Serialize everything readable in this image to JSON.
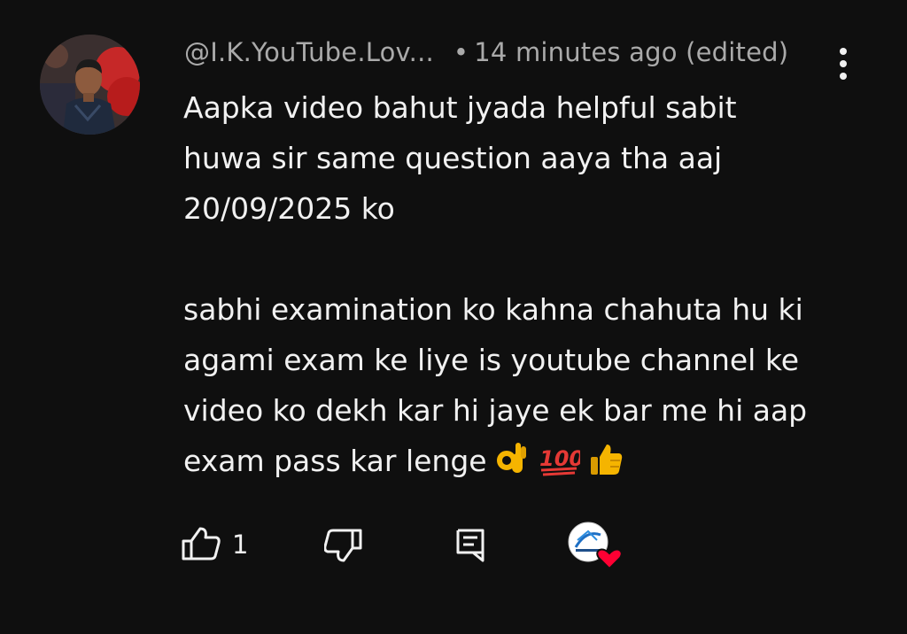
{
  "comment": {
    "author_handle": "@I.K.YouTube.Lov...",
    "separator": "•",
    "timestamp": "14 minutes ago (edited)",
    "paragraph1_lines": [
      "Aapka video bahut jyada helpful sabit",
      "huwa sir same question aaya tha aaj",
      "20/09/2025 ko"
    ],
    "paragraph2_lines": [
      "sabhi examination ko kahna chahuta hu ki",
      "agami exam ke liye is youtube channel ke",
      "video ko dekh kar hi jaye ek bar me hi aap",
      "exam pass kar lenge"
    ],
    "emojis": [
      "ok-hand",
      "hundred-points",
      "thumbs-up"
    ]
  },
  "actions": {
    "like_count": "1"
  },
  "icons": {
    "more": "more-vert-icon",
    "like": "thumb-up-icon",
    "dislike": "thumb-down-icon",
    "reply": "reply-icon",
    "creator_heart": "creator-heart-icon"
  },
  "colors": {
    "background": "#0f0f0f",
    "text": "#f1f1f1",
    "secondary_text": "#aaaaaa",
    "heart": "#ff0033"
  }
}
